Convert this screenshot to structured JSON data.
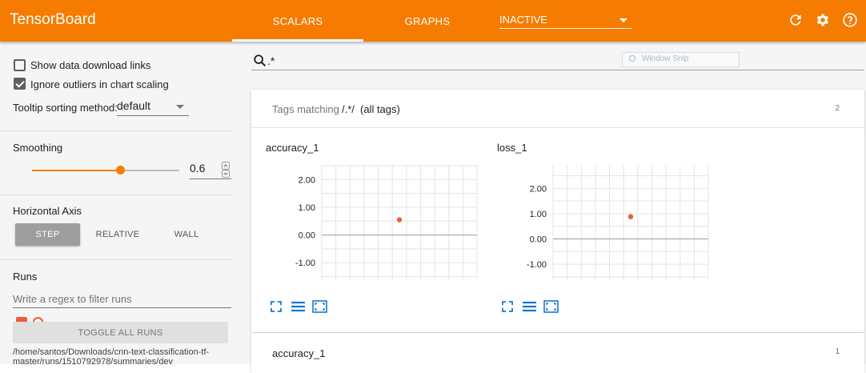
{
  "app": {
    "title": "TensorBoard"
  },
  "tabs": [
    {
      "label": "SCALARS",
      "active": true
    },
    {
      "label": "GRAPHS",
      "active": false
    }
  ],
  "tab_select": {
    "value": "INACTIVE"
  },
  "toolbar_icons": [
    "refresh-icon",
    "gear-icon",
    "help-icon"
  ],
  "accent_color": "#f57c00",
  "sidebar": {
    "show_download_links": {
      "label": "Show data download links",
      "checked": false
    },
    "ignore_outliers": {
      "label": "Ignore outliers in chart scaling",
      "checked": true
    },
    "tooltip": {
      "label": "Tooltip sorting method:",
      "value": "default"
    },
    "smoothing": {
      "title": "Smoothing",
      "value": "0.6",
      "slider_fraction": 0.6
    },
    "horizontal_axis": {
      "title": "Horizontal Axis",
      "options": [
        "STEP",
        "RELATIVE",
        "WALL"
      ],
      "selected": "STEP"
    },
    "runs": {
      "title": "Runs",
      "filter_placeholder": "Write a regex to filter runs",
      "toggle_label": "TOGGLE ALL RUNS",
      "path": "/home/santos/Downloads/cnn-text-classification-tf-master/runs/1510792978/summaries/dev"
    }
  },
  "search": {
    "value": ".*",
    "overlay_text": "Window Snip"
  },
  "tags_card": {
    "label": "Tags matching",
    "pattern": "/.*/",
    "suffix": "(all tags)",
    "count": "2"
  },
  "second_card": {
    "title": "accuracy_1",
    "count": "1"
  },
  "chart_data": [
    {
      "type": "scatter",
      "title": "accuracy_1",
      "ylim": [
        -1.6,
        2.5
      ],
      "yticks": [
        "2.00",
        "1.00",
        "0.00",
        "-1.00"
      ],
      "ytick_values": [
        2,
        1,
        0,
        -1
      ],
      "xlim": [
        0,
        1
      ],
      "points": [
        {
          "x": 0.5,
          "y": 0.55
        }
      ],
      "point_color": "#ef5c3a",
      "grid": true
    },
    {
      "type": "scatter",
      "title": "loss_1",
      "ylim": [
        -1.6,
        2.9
      ],
      "yticks": [
        "2.00",
        "1.00",
        "0.00",
        "-1.00"
      ],
      "ytick_values": [
        2,
        1,
        0,
        -1
      ],
      "xlim": [
        0,
        1
      ],
      "points": [
        {
          "x": 0.5,
          "y": 0.88
        }
      ],
      "point_color": "#ef5c3a",
      "grid": true
    }
  ]
}
